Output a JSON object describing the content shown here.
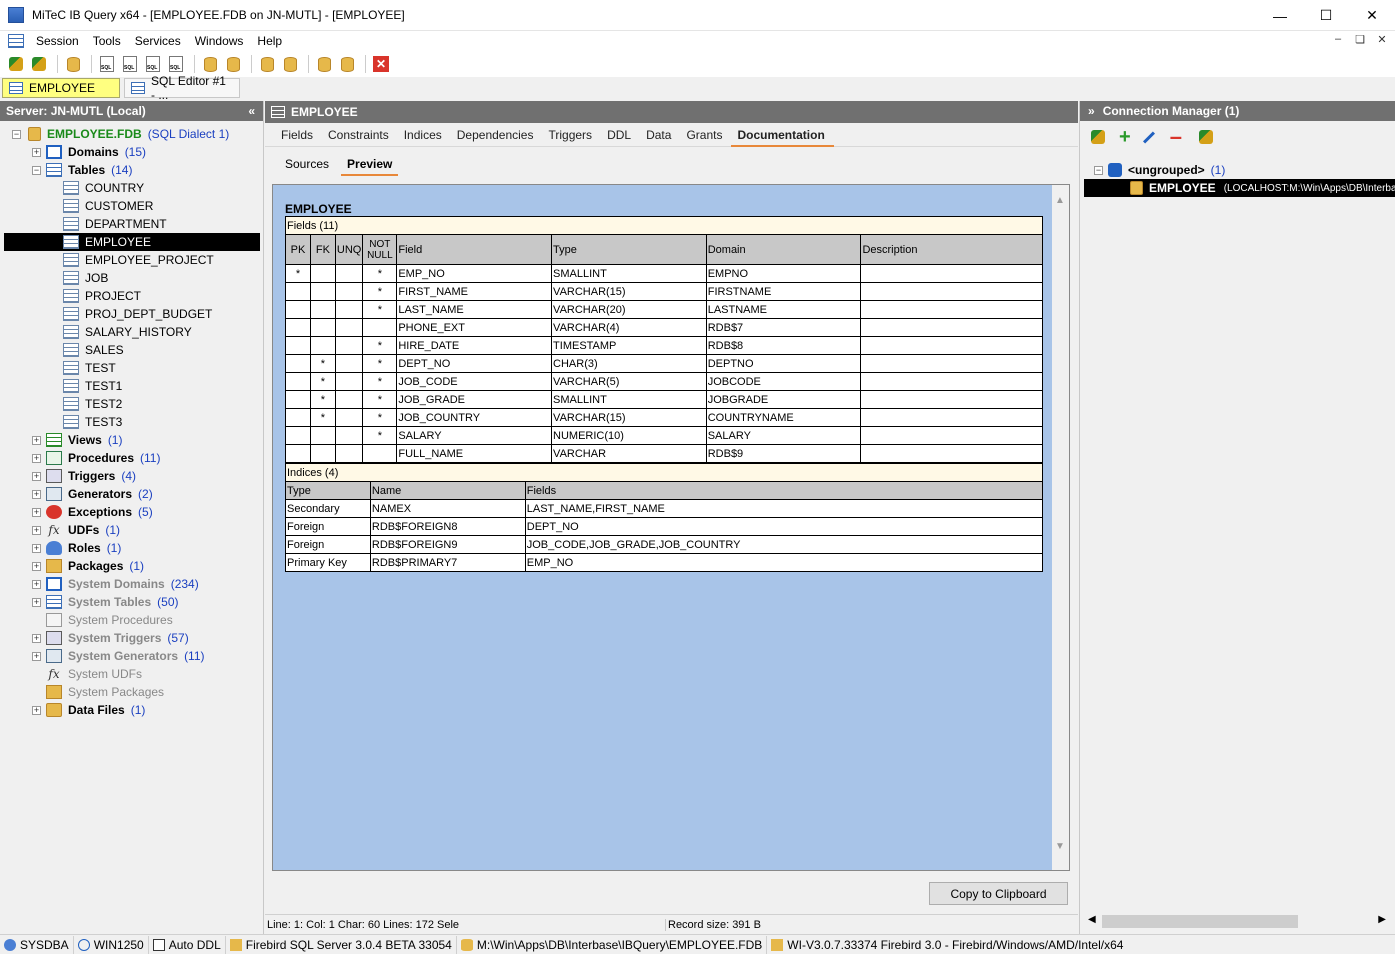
{
  "window": {
    "title": "MiTeC IB Query x64 - [EMPLOYEE.FDB on JN-MUTL] - [EMPLOYEE]"
  },
  "menu": [
    "Session",
    "Tools",
    "Services",
    "Windows",
    "Help"
  ],
  "wintabs": [
    {
      "label": "EMPLOYEE"
    },
    {
      "label": "SQL Editor #1 - ..."
    }
  ],
  "left": {
    "header": "Server: JN-MUTL (Local)",
    "db": {
      "name": "EMPLOYEE.FDB",
      "dialect": "(SQL Dialect 1)"
    },
    "groups_top": [
      {
        "label": "Domains",
        "count": "(15)"
      },
      {
        "label": "Tables",
        "count": "(14)"
      }
    ],
    "tables": [
      "COUNTRY",
      "CUSTOMER",
      "DEPARTMENT",
      "EMPLOYEE",
      "EMPLOYEE_PROJECT",
      "JOB",
      "PROJECT",
      "PROJ_DEPT_BUDGET",
      "SALARY_HISTORY",
      "SALES",
      "TEST",
      "TEST1",
      "TEST2",
      "TEST3"
    ],
    "groups_bottom": [
      {
        "label": "Views",
        "count": "(1)"
      },
      {
        "label": "Procedures",
        "count": "(11)"
      },
      {
        "label": "Triggers",
        "count": "(4)"
      },
      {
        "label": "Generators",
        "count": "(2)"
      },
      {
        "label": "Exceptions",
        "count": "(5)"
      },
      {
        "label": "UDFs",
        "count": "(1)"
      },
      {
        "label": "Roles",
        "count": "(1)"
      },
      {
        "label": "Packages",
        "count": "(1)"
      },
      {
        "label": "System Domains",
        "count": "(234)"
      },
      {
        "label": "System Tables",
        "count": "(50)"
      },
      {
        "label": "System Procedures",
        "count": ""
      },
      {
        "label": "System Triggers",
        "count": "(57)"
      },
      {
        "label": "System Generators",
        "count": "(11)"
      },
      {
        "label": "System UDFs",
        "count": ""
      },
      {
        "label": "System Packages",
        "count": ""
      },
      {
        "label": "Data Files",
        "count": "(1)"
      }
    ]
  },
  "center": {
    "header": "EMPLOYEE",
    "tabs": [
      "Fields",
      "Constraints",
      "Indices",
      "Dependencies",
      "Triggers",
      "DDL",
      "Data",
      "Grants",
      "Documentation"
    ],
    "subtabs": [
      "Sources",
      "Preview"
    ],
    "doc": {
      "title": "EMPLOYEE",
      "fields_caption": "Fields (11)",
      "fields_headers": [
        "PK",
        "FK",
        "UNQ",
        "NOT NULL",
        "Field",
        "Type",
        "Domain",
        "Description"
      ],
      "fields": [
        [
          "*",
          "",
          "",
          "*",
          "EMP_NO",
          "SMALLINT",
          "EMPNO",
          ""
        ],
        [
          "",
          "",
          "",
          "*",
          "FIRST_NAME",
          "VARCHAR(15)",
          "FIRSTNAME",
          ""
        ],
        [
          "",
          "",
          "",
          "*",
          "LAST_NAME",
          "VARCHAR(20)",
          "LASTNAME",
          ""
        ],
        [
          "",
          "",
          "",
          "",
          "PHONE_EXT",
          "VARCHAR(4)",
          "RDB$7",
          ""
        ],
        [
          "",
          "",
          "",
          "*",
          "HIRE_DATE",
          "TIMESTAMP",
          "RDB$8",
          ""
        ],
        [
          "",
          "*",
          "",
          "*",
          "DEPT_NO",
          "CHAR(3)",
          "DEPTNO",
          ""
        ],
        [
          "",
          "*",
          "",
          "*",
          "JOB_CODE",
          "VARCHAR(5)",
          "JOBCODE",
          ""
        ],
        [
          "",
          "*",
          "",
          "*",
          "JOB_GRADE",
          "SMALLINT",
          "JOBGRADE",
          ""
        ],
        [
          "",
          "*",
          "",
          "*",
          "JOB_COUNTRY",
          "VARCHAR(15)",
          "COUNTRYNAME",
          ""
        ],
        [
          "",
          "",
          "",
          "*",
          "SALARY",
          "NUMERIC(10)",
          "SALARY",
          ""
        ],
        [
          "",
          "",
          "",
          "",
          "FULL_NAME",
          "VARCHAR",
          "RDB$9",
          ""
        ]
      ],
      "indices_caption": "Indices (4)",
      "indices_headers": [
        "Type",
        "Name",
        "Fields"
      ],
      "indices": [
        [
          "Secondary",
          "NAMEX",
          "LAST_NAME,FIRST_NAME"
        ],
        [
          "Foreign",
          "RDB$FOREIGN8",
          "DEPT_NO"
        ],
        [
          "Foreign",
          "RDB$FOREIGN9",
          "JOB_CODE,JOB_GRADE,JOB_COUNTRY"
        ],
        [
          "Primary Key",
          "RDB$PRIMARY7",
          "EMP_NO"
        ]
      ]
    },
    "copy_button": "Copy to Clipboard",
    "status": {
      "pos": "Line: 1:  Col: 1  Char: 60  Lines: 172  Sele",
      "record": "Record size: 391 B"
    }
  },
  "right": {
    "header": "Connection Manager (1)",
    "group": {
      "label": "<ungrouped>",
      "count": "(1)"
    },
    "conn": {
      "name": "EMPLOYEE",
      "path": "(LOCALHOST:M:\\Win\\Apps\\DB\\Interbase\\I"
    }
  },
  "statusbar": [
    "SYSDBA",
    "WIN1250",
    "Auto DDL",
    "Firebird SQL Server 3.0.4 BETA 33054",
    "M:\\Win\\Apps\\DB\\Interbase\\IBQuery\\EMPLOYEE.FDB",
    "WI-V3.0.7.33374 Firebird 3.0 - Firebird/Windows/AMD/Intel/x64"
  ]
}
